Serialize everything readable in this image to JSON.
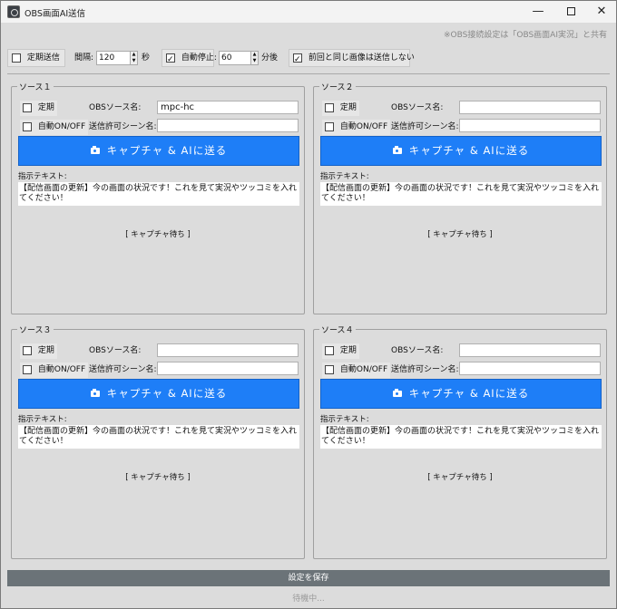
{
  "window": {
    "title": "OBS画面AI送信",
    "minimize": "—",
    "close": "✕"
  },
  "note": "※OBS接続設定は「OBS画面AI実況」と共有",
  "toolbar": {
    "periodic_label": "定期送信",
    "periodic_checked": false,
    "interval_label": "間隔:",
    "interval_value": "120",
    "interval_unit": "秒",
    "autostop_label": "自動停止:",
    "autostop_checked": true,
    "autostop_value": "60",
    "autostop_unit": "分後",
    "skip_same_label": "前回と同じ画像は送信しない",
    "skip_same_checked": true
  },
  "sources": [
    {
      "legend": "ソース１",
      "periodic_label": "定期",
      "auto_label": "自動ON/OFF",
      "obs_source_label": "OBSソース名:",
      "obs_source_value": "mpc-hc",
      "scene_label": "送信許可シーン名:",
      "scene_value": "",
      "capture_button": "キャプチャ & AIに送る",
      "instruction_label": "指示テキスト:",
      "instruction_text": "【配信画面の更新】今の画面の状況です！これを見て実況やツッコミを入れてください！",
      "status": "[ キャプチャ待ち ]"
    },
    {
      "legend": "ソース２",
      "periodic_label": "定期",
      "auto_label": "自動ON/OFF",
      "obs_source_label": "OBSソース名:",
      "obs_source_value": "",
      "scene_label": "送信許可シーン名:",
      "scene_value": "",
      "capture_button": "キャプチャ & AIに送る",
      "instruction_label": "指示テキスト:",
      "instruction_text": "【配信画面の更新】今の画面の状況です！これを見て実況やツッコミを入れてください！",
      "status": "[ キャプチャ待ち ]"
    },
    {
      "legend": "ソース３",
      "periodic_label": "定期",
      "auto_label": "自動ON/OFF",
      "obs_source_label": "OBSソース名:",
      "obs_source_value": "",
      "scene_label": "送信許可シーン名:",
      "scene_value": "",
      "capture_button": "キャプチャ & AIに送る",
      "instruction_label": "指示テキスト:",
      "instruction_text": "【配信画面の更新】今の画面の状況です！これを見て実況やツッコミを入れてください！",
      "status": "[ キャプチャ待ち ]"
    },
    {
      "legend": "ソース４",
      "periodic_label": "定期",
      "auto_label": "自動ON/OFF",
      "obs_source_label": "OBSソース名:",
      "obs_source_value": "",
      "scene_label": "送信許可シーン名:",
      "scene_value": "",
      "capture_button": "キャプチャ & AIに送る",
      "instruction_label": "指示テキスト:",
      "instruction_text": "【配信画面の更新】今の画面の状況です！これを見て実況やツッコミを入れてください！",
      "status": "[ キャプチャ待ち ]"
    }
  ],
  "save_button": "設定を保存",
  "footer_status": "待機中..."
}
